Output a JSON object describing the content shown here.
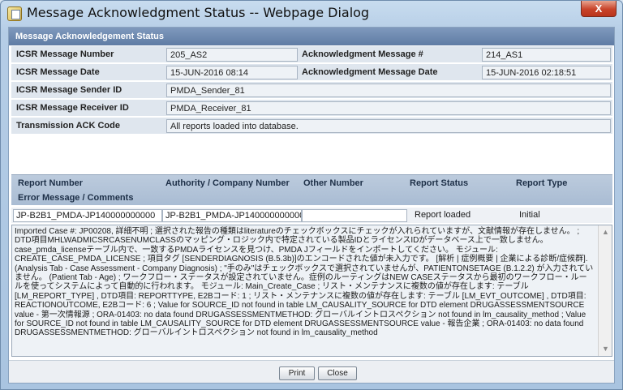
{
  "window": {
    "title": "Message Acknowledgment Status -- Webpage Dialog",
    "close_label": "X"
  },
  "section": {
    "title": "Message Acknowledgement Status"
  },
  "fields": {
    "icsr_message_number": {
      "label": "ICSR Message Number",
      "value": "205_AS2"
    },
    "ack_message_number": {
      "label": "Acknowledgment Message #",
      "value": "214_AS1"
    },
    "icsr_message_date": {
      "label": "ICSR Message Date",
      "value": "15-JUN-2016 08:14"
    },
    "ack_message_date": {
      "label": "Acknowledgment Message Date",
      "value": "15-JUN-2016 02:18:51"
    },
    "sender_id": {
      "label": "ICSR Message Sender ID",
      "value": "PMDA_Sender_81"
    },
    "receiver_id": {
      "label": "ICSR Message Receiver ID",
      "value": "PMDA_Receiver_81"
    },
    "transmission_ack_code": {
      "label": "Transmission ACK Code",
      "value": "All reports loaded into database."
    }
  },
  "grid": {
    "columns": [
      "Report Number",
      "Authority / Company Number",
      "Other Number",
      "Report Status",
      "Report Type"
    ],
    "error_label": "Error Message / Comments",
    "row": {
      "report_number": "JP-B2B1_PMDA-JP140000000000",
      "authority_number": "JP-B2B1_PMDA-JP140000000000",
      "other_number": "",
      "report_status": "Report loaded",
      "report_type": "Initial"
    },
    "message": "Imported Case #: JP00208, 詳細不明 ; 選択された報告の種類はliteratureのチェックボックスにチェックが入れられていますが、文献情報が存在しません。 ; DTD項目MHLWADMICSRCASENUMCLASSのマッピング・ロジック内で特定されている製品IDとライセンスIDがデータベース上で一致しません。case_pmda_licenseテーブル内で、一致するPMDAライセンスを見つけ、PMDA Jフィールドをインポートしてください。 モジュール: CREATE_CASE_PMDA_LICENSE ; 項目タグ [SENDERDIAGNOSIS (B.5.3b)]のエンコードされた値が未入力です。 [解析 | 症例概要 | 企業による診断/症候群]. (Analysis Tab - Case Assessment - Company Diagnosis) ; \"手のみ\"はチェックボックスで選択されていませんが、PATIENTONSETAGE (B.1.2.2) が入力されていません。 (Patient Tab - Age) ; ワークフロー・ステータスが設定されていません。症例のルーティングはNEW CASEステータスから最初のワークフロー・ルールを使ってシステムによって自動的に行われます。 モジュール: Main_Create_Case ; リスト・メンテナンスに複数の値が存在します: テーブル [LM_REPORT_TYPE] , DTD項目: REPORTTYPE, E2Bコード: 1 ; リスト・メンテナンスに複数の値が存在します: テーブル [LM_EVT_OUTCOME] , DTD項目: REACTIONOUTCOME, E2Bコード: 6 ; Value for SOURCE_ID not found in table LM_CAUSALITY_SOURCE for DTD element DRUGASSESSMENTSOURCE value - 第一次情報源 ; ORA-01403: no data found DRUGASSESSMENTMETHOD: グローバルイントロスペクション not found in lm_causality_method ; Value for SOURCE_ID not found in table LM_CAUSALITY_SOURCE for DTD element DRUGASSESSMENTSOURCE value - 報告企業 ; ORA-01403: no data found DRUGASSESSMENTMETHOD: グローバルイントロスペクション not found in lm_causality_method"
  },
  "buttons": {
    "print": "Print",
    "close": "Close"
  }
}
